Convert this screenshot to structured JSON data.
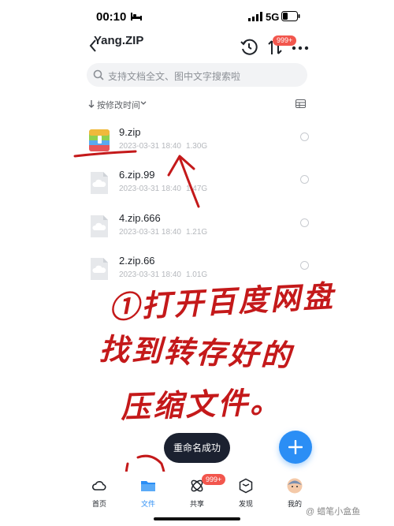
{
  "status_bar": {
    "time": "00:10",
    "network": "5G",
    "icons": [
      "bed-icon",
      "signal-icon",
      "battery-icon"
    ]
  },
  "header": {
    "title": "Yang.ZIP",
    "transfer_badge": "999+",
    "icons": [
      "back-icon",
      "history-icon",
      "transfer-icon",
      "more-icon"
    ]
  },
  "search": {
    "placeholder": "支持文档全文、图中文字搜索啦"
  },
  "sort": {
    "label": "按修改时间"
  },
  "files": [
    {
      "name": "9.zip",
      "date": "2023-03-31 18:40",
      "size": "1.30G",
      "icon": "zip-archive-icon"
    },
    {
      "name": "6.zip.99",
      "date": "2023-03-31 18:40",
      "size": "1.47G",
      "icon": "cloud-file-icon"
    },
    {
      "name": "4.zip.666",
      "date": "2023-03-31 18:40",
      "size": "1.21G",
      "icon": "cloud-file-icon"
    },
    {
      "name": "2.zip.66",
      "date": "2023-03-31 18:40",
      "size": "1.01G",
      "icon": "cloud-file-icon"
    }
  ],
  "toast": {
    "text": "重命名成功"
  },
  "tabbar": {
    "items": [
      {
        "label": "首页",
        "icon": "home-cloud-icon"
      },
      {
        "label": "文件",
        "icon": "folder-icon"
      },
      {
        "label": "共享",
        "icon": "share-icon"
      },
      {
        "label": "发现",
        "icon": "discover-icon"
      },
      {
        "label": "我的",
        "icon": "avatar-icon"
      }
    ],
    "share_badge": "999+",
    "active_index": 1
  },
  "annotation": {
    "line1": "①打开百度网盘",
    "line2": "找到转存好的",
    "line3": "压缩文件。"
  },
  "watermark": "@ 蜡笔小盒鱼",
  "colors": {
    "accent": "#2b8ef5",
    "badge": "#f2564d",
    "annotation": "#c4191a",
    "toast_bg": "#1b2130"
  }
}
